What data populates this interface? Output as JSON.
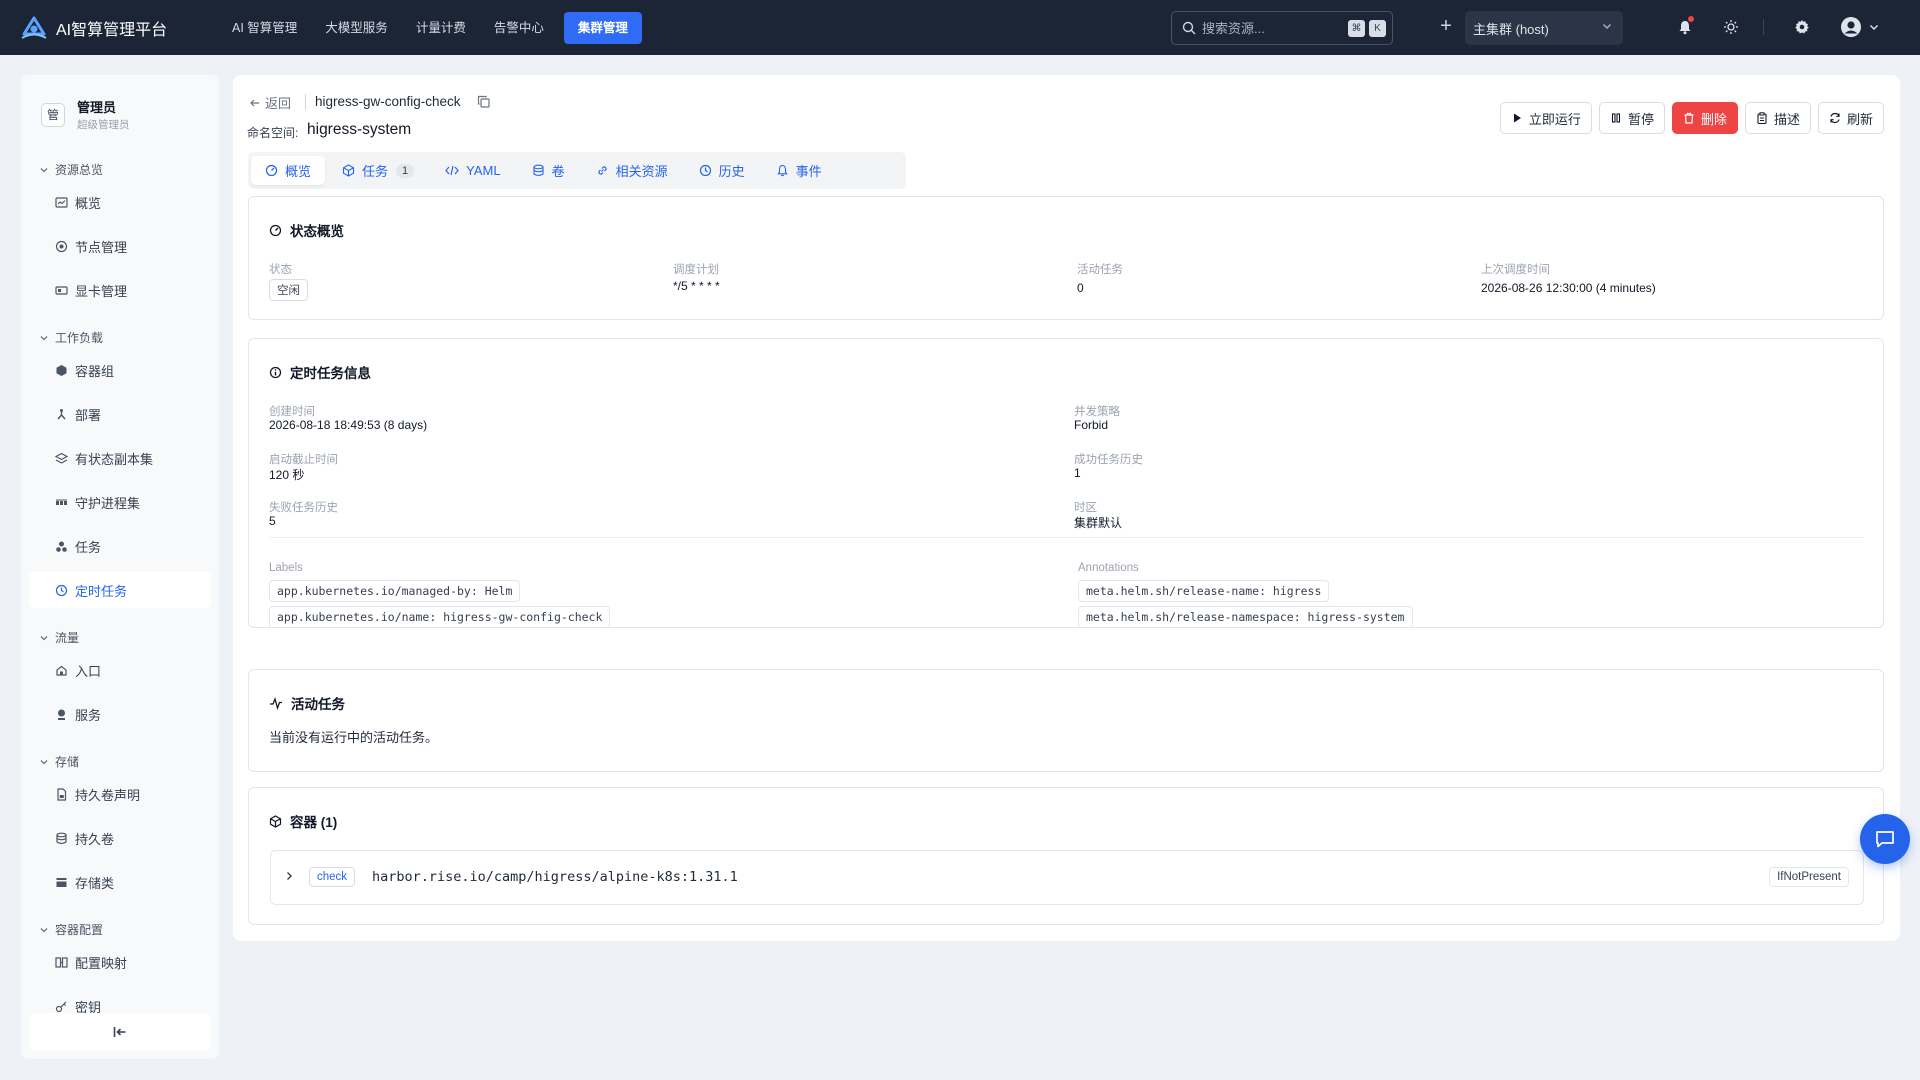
{
  "app": {
    "title": "AI智算管理平台",
    "nav": [
      "AI 智算管理",
      "大模型服务",
      "计量计费",
      "告警中心"
    ],
    "nav_active": "集群管理"
  },
  "header": {
    "search_placeholder": "搜索资源...",
    "kbd_1": "⌘",
    "kbd_2": "K",
    "cluster": "主集群 (host)"
  },
  "sidebar": {
    "user_name": "管理员",
    "user_role": "超级管理员",
    "avatar_text": "管",
    "groups": {
      "overview": "资源总览",
      "workload": "工作负载",
      "traffic": "流量",
      "storage": "存储",
      "config": "容器配置"
    },
    "items": {
      "overview": "概览",
      "nodes": "节点管理",
      "gpu": "显卡管理",
      "pods": "容器组",
      "deployments": "部署",
      "statefulsets": "有状态副本集",
      "daemonsets": "守护进程集",
      "jobs": "任务",
      "cronjobs": "定时任务",
      "ingress": "入口",
      "services": "服务",
      "pvc": "持久卷声明",
      "pv": "持久卷",
      "storageclass": "存储类",
      "configmap": "配置映射",
      "secret": "密钥"
    }
  },
  "page": {
    "back": "返回",
    "name": "higress-gw-config-check",
    "ns_label": "命名空间:",
    "namespace": "higress-system",
    "actions": {
      "run": "立即运行",
      "pause": "暂停",
      "delete": "删除",
      "describe": "描述",
      "refresh": "刷新"
    },
    "tabs": {
      "overview": "概览",
      "jobs": "任务",
      "jobs_count": "1",
      "yaml": "YAML",
      "volumes": "卷",
      "related": "相关资源",
      "history": "历史",
      "events": "事件"
    }
  },
  "status": {
    "title": "状态概览",
    "state_label": "状态",
    "state": "空闲",
    "schedule_label": "调度计划",
    "schedule": "*/5 * * * *",
    "active_label": "活动任务",
    "active": "0",
    "last_label": "上次调度时间",
    "last": "2026-08-26 12:30:00 (4 minutes)"
  },
  "info": {
    "title": "定时任务信息",
    "created_label": "创建时间",
    "created": "2026-08-18 18:49:53 (8 days)",
    "deadline_label": "启动截止时间",
    "deadline": "120 秒",
    "failed_label": "失败任务历史",
    "failed": "5",
    "concurrency_label": "并发策略",
    "concurrency": "Forbid",
    "success_label": "成功任务历史",
    "success": "1",
    "tz_label": "时区",
    "tz": "集群默认",
    "labels_title": "Labels",
    "labels": [
      "app.kubernetes.io/managed-by: Helm",
      "app.kubernetes.io/name: higress-gw-config-check"
    ],
    "annotations_title": "Annotations",
    "annotations": [
      "meta.helm.sh/release-name: higress",
      "meta.helm.sh/release-namespace: higress-system"
    ]
  },
  "active_jobs": {
    "title": "活动任务",
    "empty": "当前没有运行中的活动任务。"
  },
  "containers": {
    "title": "容器 (1)",
    "name": "check",
    "image": "harbor.rise.io/camp/higress/alpine-k8s:1.31.1",
    "pull_policy": "IfNotPresent"
  },
  "colors": {
    "topbar": "#1b2536",
    "accent": "#2563eb",
    "danger": "#ef4444"
  }
}
